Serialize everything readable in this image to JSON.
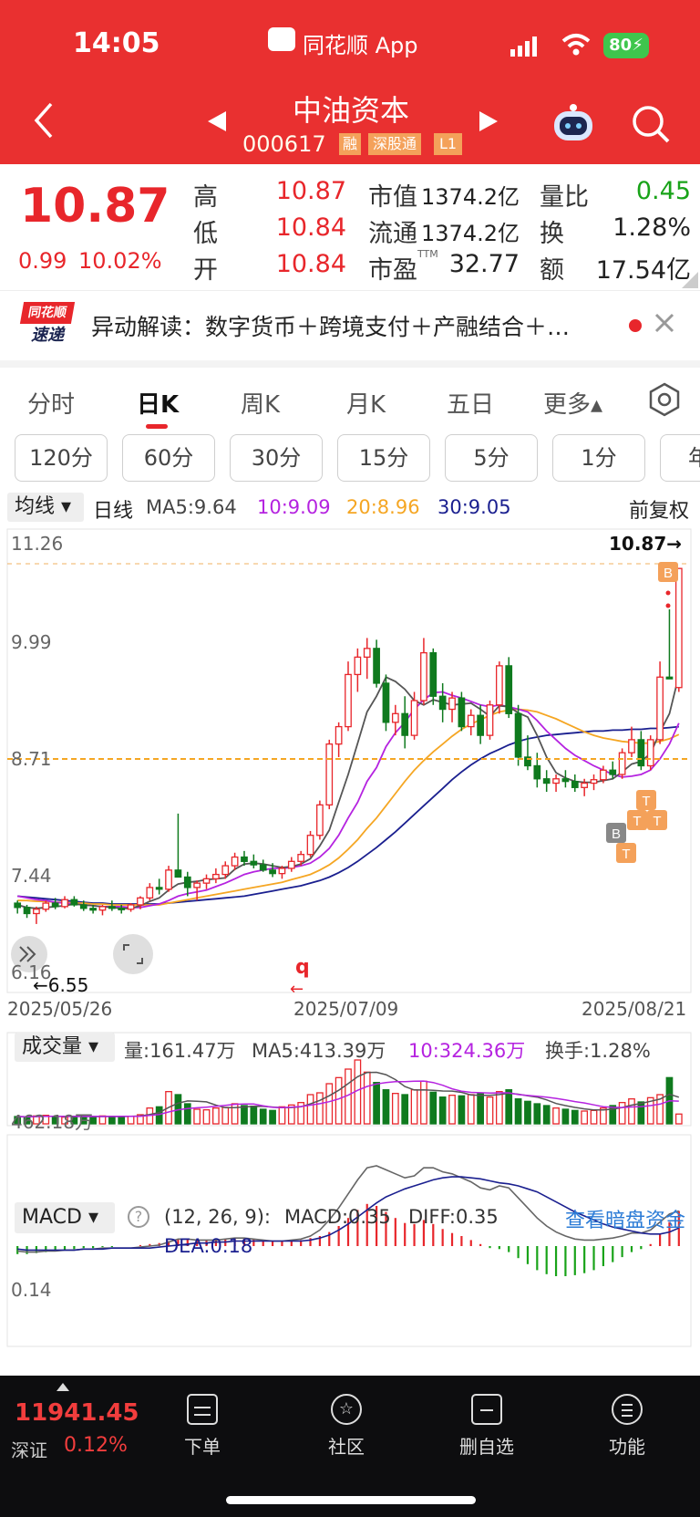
{
  "status": {
    "time": "14:05",
    "app": "同花顺 App",
    "battery": "80"
  },
  "header": {
    "name": "中油资本",
    "code": "000617",
    "tags": [
      "融",
      "深股通",
      "L1"
    ]
  },
  "quote": {
    "price": "10.87",
    "change": "0.99",
    "pct": "10.02%",
    "high_label": "高",
    "high": "10.87",
    "low_label": "低",
    "low": "10.84",
    "open_label": "开",
    "open": "10.84",
    "mcap_label": "市值",
    "mcap": "1374.2亿",
    "float_label": "流通",
    "float": "1374.2亿",
    "pe_label": "市盈",
    "pe_sup": "TTM",
    "pe": "32.77",
    "vr_label": "量比",
    "vr": "0.45",
    "turn_label": "换",
    "turn": "1.28%",
    "amt_label": "额",
    "amt": "17.54亿"
  },
  "news": {
    "logo_top": "同花顺",
    "logo_bottom": "速递",
    "text": "异动解读：数字货币＋跨境支付＋产融结合＋…"
  },
  "tabs": [
    "分时",
    "日K",
    "周K",
    "月K",
    "五日",
    "更多▴"
  ],
  "periods": [
    "120分",
    "60分",
    "30分",
    "15分",
    "5分",
    "1分",
    "年"
  ],
  "ma": {
    "btn": "均线",
    "type": "日线",
    "ma5": "MA5:9.64",
    "ma10": "10:9.09",
    "ma20": "20:8.96",
    "ma30": "30:9.05",
    "adj": "前复权"
  },
  "colors": {
    "up": "#e8262b",
    "down": "#0f7a1e",
    "ma5": "#555555",
    "ma10": "#b523e0",
    "ma20": "#f5a623",
    "ma30": "#1a1f8f"
  },
  "kchart": {
    "y_labels": [
      "11.26",
      "9.99",
      "8.71",
      "7.44",
      "6.16"
    ],
    "last_price": "10.87→",
    "min_label": "←6.55",
    "dates": [
      "2025/05/26",
      "2025/07/09",
      "2025/08/21"
    ],
    "q_label": "q"
  },
  "volume": {
    "btn": "成交量",
    "vol": "量:161.47万",
    "ma5": "MA5:413.39万",
    "ma10": "10:324.36万",
    "turn": "换手:1.28%",
    "y_label": "462.18万"
  },
  "macd": {
    "btn": "MACD",
    "help": "?",
    "params": "(12, 26, 9):",
    "macd": "MACD:0.35",
    "diff": "DIFF:0.35",
    "dea": "DEA:0.18",
    "link": "查看暗盘资金",
    "y_label": "0.14"
  },
  "bottom": {
    "index_value": "11941.45",
    "index_name": "深证",
    "index_pct": "0.12%",
    "nav": [
      "下单",
      "社区",
      "删自选",
      "功能"
    ]
  },
  "chart_data": {
    "type": "candlestick",
    "ylim": [
      6.16,
      11.26
    ],
    "candles": [
      [
        7.02,
        7.05,
        6.9,
        6.97
      ],
      [
        6.97,
        7.0,
        6.85,
        6.9
      ],
      [
        6.9,
        6.98,
        6.78,
        6.95
      ],
      [
        6.95,
        7.05,
        6.92,
        7.02
      ],
      [
        7.02,
        7.08,
        6.95,
        6.98
      ],
      [
        6.98,
        7.1,
        6.96,
        7.06
      ],
      [
        7.06,
        7.1,
        6.98,
        7.0
      ],
      [
        7.0,
        7.05,
        6.93,
        6.96
      ],
      [
        6.96,
        7.0,
        6.9,
        6.94
      ],
      [
        6.94,
        7.0,
        6.88,
        6.98
      ],
      [
        6.98,
        7.05,
        6.93,
        6.96
      ],
      [
        6.96,
        7.0,
        6.9,
        6.95
      ],
      [
        6.95,
        7.02,
        6.92,
        7.0
      ],
      [
        7.0,
        7.1,
        6.95,
        7.08
      ],
      [
        7.08,
        7.25,
        7.05,
        7.2
      ],
      [
        7.2,
        7.3,
        7.12,
        7.18
      ],
      [
        7.18,
        7.45,
        7.15,
        7.4
      ],
      [
        7.4,
        8.05,
        7.35,
        7.32
      ],
      [
        7.32,
        7.38,
        7.1,
        7.2
      ],
      [
        7.2,
        7.28,
        7.05,
        7.25
      ],
      [
        7.25,
        7.35,
        7.18,
        7.3
      ],
      [
        7.3,
        7.42,
        7.25,
        7.35
      ],
      [
        7.35,
        7.5,
        7.3,
        7.45
      ],
      [
        7.45,
        7.6,
        7.4,
        7.55
      ],
      [
        7.55,
        7.62,
        7.45,
        7.5
      ],
      [
        7.5,
        7.58,
        7.42,
        7.46
      ],
      [
        7.46,
        7.52,
        7.38,
        7.4
      ],
      [
        7.4,
        7.48,
        7.32,
        7.36
      ],
      [
        7.36,
        7.45,
        7.3,
        7.42
      ],
      [
        7.42,
        7.55,
        7.38,
        7.5
      ],
      [
        7.5,
        7.62,
        7.45,
        7.58
      ],
      [
        7.58,
        7.85,
        7.55,
        7.8
      ],
      [
        7.8,
        8.2,
        7.75,
        8.15
      ],
      [
        8.15,
        8.9,
        8.1,
        8.85
      ],
      [
        8.85,
        9.1,
        8.7,
        9.05
      ],
      [
        9.05,
        9.8,
        9.0,
        9.65
      ],
      [
        9.65,
        9.95,
        9.45,
        9.85
      ],
      [
        9.85,
        10.07,
        9.6,
        9.95
      ],
      [
        9.95,
        10.05,
        9.5,
        9.55
      ],
      [
        9.55,
        9.65,
        9.0,
        9.1
      ],
      [
        9.1,
        9.3,
        8.95,
        9.2
      ],
      [
        9.2,
        9.4,
        8.8,
        8.95
      ],
      [
        8.95,
        9.45,
        8.9,
        9.35
      ],
      [
        9.35,
        10.07,
        9.3,
        9.9
      ],
      [
        9.9,
        9.95,
        9.3,
        9.4
      ],
      [
        9.4,
        9.55,
        9.1,
        9.25
      ],
      [
        9.25,
        9.45,
        9.1,
        9.38
      ],
      [
        9.38,
        9.45,
        9.0,
        9.05
      ],
      [
        9.05,
        9.25,
        8.95,
        9.18
      ],
      [
        9.18,
        9.3,
        8.85,
        8.95
      ],
      [
        8.95,
        9.35,
        8.9,
        9.3
      ],
      [
        9.3,
        9.8,
        9.2,
        9.75
      ],
      [
        9.75,
        9.85,
        9.15,
        9.2
      ],
      [
        9.2,
        9.3,
        8.6,
        8.7
      ],
      [
        8.7,
        8.95,
        8.55,
        8.6
      ],
      [
        8.6,
        8.75,
        8.35,
        8.45
      ],
      [
        8.45,
        8.55,
        8.3,
        8.4
      ],
      [
        8.4,
        8.5,
        8.3,
        8.45
      ],
      [
        8.45,
        8.55,
        8.35,
        8.42
      ],
      [
        8.42,
        8.5,
        8.3,
        8.35
      ],
      [
        8.35,
        8.45,
        8.25,
        8.4
      ],
      [
        8.4,
        8.5,
        8.32,
        8.44
      ],
      [
        8.44,
        8.6,
        8.4,
        8.55
      ],
      [
        8.55,
        8.65,
        8.45,
        8.5
      ],
      [
        8.5,
        8.8,
        8.45,
        8.75
      ],
      [
        8.75,
        9.05,
        8.7,
        8.9
      ],
      [
        8.9,
        9.0,
        8.55,
        8.6
      ],
      [
        8.6,
        8.95,
        8.55,
        8.9
      ],
      [
        8.9,
        9.8,
        8.85,
        9.62
      ],
      [
        9.62,
        10.4,
        9.6,
        9.6
      ],
      [
        9.5,
        10.87,
        9.45,
        10.87
      ]
    ],
    "ma5": [
      7.0,
      6.97,
      6.96,
      6.97,
      6.98,
      6.99,
      7.01,
      7.0,
      6.99,
      6.98,
      6.97,
      6.96,
      6.96,
      6.99,
      7.04,
      7.08,
      7.17,
      7.24,
      7.26,
      7.27,
      7.29,
      7.3,
      7.31,
      7.41,
      7.47,
      7.48,
      7.47,
      7.45,
      7.43,
      7.44,
      7.47,
      7.53,
      7.68,
      7.86,
      8.18,
      8.5,
      8.86,
      9.22,
      9.4,
      9.62,
      9.57,
      9.48,
      9.35,
      9.3,
      9.36,
      9.33,
      9.3,
      9.31,
      9.32,
      9.25,
      9.17,
      9.29,
      9.28,
      9.21,
      9.16,
      8.95,
      8.7,
      8.52,
      8.46,
      8.42,
      8.41,
      8.41,
      8.43,
      8.45,
      8.53,
      8.62,
      8.65,
      8.74,
      8.99,
      9.2,
      9.64
    ],
    "ma10": [
      7.1,
      7.08,
      7.06,
      7.05,
      7.03,
      7.02,
      7.01,
      7.0,
      6.99,
      6.98,
      6.98,
      6.98,
      6.97,
      6.97,
      6.99,
      7.01,
      7.05,
      7.1,
      7.13,
      7.15,
      7.17,
      7.21,
      7.25,
      7.3,
      7.35,
      7.38,
      7.4,
      7.42,
      7.42,
      7.43,
      7.45,
      7.48,
      7.55,
      7.65,
      7.8,
      8.0,
      8.18,
      8.42,
      8.58,
      8.82,
      8.98,
      9.1,
      9.25,
      9.36,
      9.44,
      9.45,
      9.41,
      9.38,
      9.34,
      9.3,
      9.28,
      9.3,
      9.28,
      9.25,
      9.22,
      9.12,
      9.0,
      8.9,
      8.8,
      8.72,
      8.66,
      8.6,
      8.55,
      8.5,
      8.47,
      8.48,
      8.5,
      8.55,
      8.68,
      8.85,
      9.09
    ],
    "ma20": [
      7.05,
      7.05,
      7.04,
      7.04,
      7.03,
      7.03,
      7.02,
      7.02,
      7.01,
      7.01,
      7.0,
      7.0,
      7.0,
      7.0,
      7.0,
      7.0,
      7.02,
      7.04,
      7.06,
      7.08,
      7.1,
      7.12,
      7.14,
      7.16,
      7.18,
      7.2,
      7.22,
      7.24,
      7.26,
      7.29,
      7.32,
      7.35,
      7.4,
      7.46,
      7.54,
      7.64,
      7.75,
      7.88,
      8.0,
      8.14,
      8.28,
      8.42,
      8.55,
      8.66,
      8.76,
      8.85,
      8.94,
      9.02,
      9.08,
      9.13,
      9.18,
      9.22,
      9.24,
      9.25,
      9.24,
      9.22,
      9.18,
      9.14,
      9.09,
      9.04,
      8.99,
      8.95,
      8.92,
      8.9,
      8.88,
      8.87,
      8.86,
      8.86,
      8.88,
      8.91,
      8.96
    ],
    "ma30": [
      7.1,
      7.09,
      7.08,
      7.07,
      7.06,
      7.05,
      7.04,
      7.03,
      7.02,
      7.02,
      7.01,
      7.01,
      7.01,
      7.01,
      7.01,
      7.01,
      7.02,
      7.03,
      7.04,
      7.05,
      7.06,
      7.07,
      7.08,
      7.09,
      7.1,
      7.12,
      7.14,
      7.16,
      7.18,
      7.2,
      7.22,
      7.25,
      7.28,
      7.32,
      7.37,
      7.43,
      7.5,
      7.58,
      7.66,
      7.75,
      7.84,
      7.94,
      8.04,
      8.14,
      8.24,
      8.34,
      8.44,
      8.53,
      8.61,
      8.68,
      8.74,
      8.79,
      8.84,
      8.88,
      8.91,
      8.93,
      8.95,
      8.96,
      8.97,
      8.98,
      8.99,
      9.0,
      9.0,
      9.01,
      9.01,
      9.02,
      9.02,
      9.03,
      9.03,
      9.04,
      9.05
    ],
    "volume": [
      120,
      110,
      130,
      140,
      120,
      110,
      125,
      115,
      120,
      130,
      120,
      118,
      125,
      150,
      260,
      280,
      530,
      480,
      330,
      240,
      230,
      260,
      270,
      330,
      300,
      290,
      240,
      220,
      280,
      310,
      350,
      480,
      510,
      660,
      760,
      900,
      1050,
      850,
      680,
      560,
      500,
      480,
      560,
      700,
      520,
      440,
      470,
      460,
      480,
      500,
      440,
      530,
      560,
      410,
      370,
      330,
      300,
      260,
      240,
      220,
      210,
      220,
      260,
      300,
      350,
      410,
      360,
      430,
      480,
      760,
      161
    ],
    "macd": [
      -0.08,
      -0.08,
      -0.07,
      -0.06,
      -0.05,
      -0.04,
      -0.03,
      -0.02,
      -0.02,
      -0.01,
      -0.01,
      0.0,
      0.0,
      0.01,
      0.02,
      0.03,
      0.05,
      0.07,
      0.07,
      0.06,
      0.06,
      0.06,
      0.07,
      0.08,
      0.08,
      0.07,
      0.06,
      0.05,
      0.05,
      0.05,
      0.06,
      0.08,
      0.1,
      0.14,
      0.2,
      0.28,
      0.36,
      0.42,
      0.4,
      0.34,
      0.28,
      0.23,
      0.22,
      0.26,
      0.22,
      0.17,
      0.13,
      0.1,
      0.06,
      0.02,
      -0.02,
      -0.03,
      -0.06,
      -0.12,
      -0.18,
      -0.24,
      -0.28,
      -0.3,
      -0.3,
      -0.29,
      -0.27,
      -0.24,
      -0.2,
      -0.16,
      -0.11,
      -0.06,
      -0.03,
      0.02,
      0.12,
      0.24,
      0.35
    ],
    "diff": [
      -0.05,
      -0.06,
      -0.06,
      -0.05,
      -0.05,
      -0.04,
      -0.04,
      -0.03,
      -0.03,
      -0.02,
      -0.02,
      -0.02,
      -0.02,
      -0.01,
      0.0,
      0.01,
      0.04,
      0.07,
      0.07,
      0.06,
      0.06,
      0.06,
      0.07,
      0.08,
      0.08,
      0.07,
      0.06,
      0.05,
      0.05,
      0.06,
      0.07,
      0.1,
      0.16,
      0.26,
      0.38,
      0.52,
      0.66,
      0.78,
      0.8,
      0.76,
      0.72,
      0.68,
      0.7,
      0.78,
      0.78,
      0.74,
      0.72,
      0.68,
      0.64,
      0.58,
      0.56,
      0.6,
      0.58,
      0.48,
      0.38,
      0.28,
      0.2,
      0.14,
      0.1,
      0.07,
      0.06,
      0.06,
      0.07,
      0.08,
      0.1,
      0.13,
      0.13,
      0.16,
      0.24,
      0.32,
      0.35
    ],
    "dea": [
      -0.03,
      -0.04,
      -0.04,
      -0.04,
      -0.04,
      -0.04,
      -0.04,
      -0.03,
      -0.03,
      -0.03,
      -0.02,
      -0.02,
      -0.02,
      -0.02,
      -0.02,
      -0.01,
      0.0,
      0.01,
      0.02,
      0.03,
      0.03,
      0.04,
      0.04,
      0.05,
      0.05,
      0.05,
      0.05,
      0.05,
      0.05,
      0.05,
      0.05,
      0.06,
      0.08,
      0.11,
      0.16,
      0.22,
      0.29,
      0.36,
      0.43,
      0.49,
      0.53,
      0.57,
      0.6,
      0.63,
      0.66,
      0.68,
      0.69,
      0.69,
      0.68,
      0.67,
      0.65,
      0.63,
      0.62,
      0.6,
      0.57,
      0.54,
      0.49,
      0.44,
      0.39,
      0.34,
      0.3,
      0.26,
      0.22,
      0.19,
      0.17,
      0.15,
      0.13,
      0.12,
      0.12,
      0.14,
      0.18
    ]
  }
}
